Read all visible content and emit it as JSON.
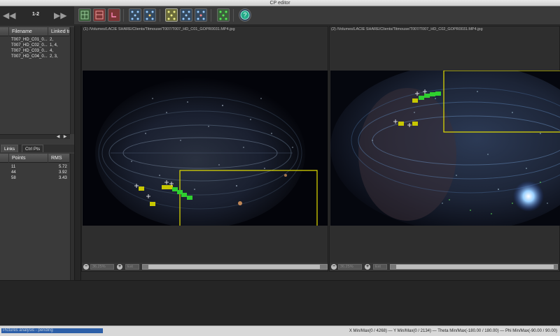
{
  "window": {
    "title": "CP editor"
  },
  "nav": {
    "pair": "1-2"
  },
  "images_table": {
    "headers": [
      "Filename",
      "Linked to"
    ],
    "rows": [
      {
        "filename": "T007_HD_C01_0...",
        "linked": "2,"
      },
      {
        "filename": "T007_HD_C02_0...",
        "linked": "1, 4,"
      },
      {
        "filename": "T007_HD_C03_0...",
        "linked": "4,"
      },
      {
        "filename": "T007_HD_C04_0...",
        "linked": "2, 3,"
      }
    ]
  },
  "tabs": [
    "Links",
    "Ctrl Pts"
  ],
  "links_table": {
    "headers": [
      "",
      "Points",
      "RMS"
    ],
    "rows": [
      {
        "points": "11",
        "rms": "5.72"
      },
      {
        "points": "44",
        "rms": "3.92"
      },
      {
        "points": "58",
        "rms": "3.43"
      }
    ]
  },
  "pane_left": {
    "path": "(1) /Volumes/LACIE SHARE/Clients/Titmouse/T007/T007_HD_C01_GOPR0031.MP4.jpg",
    "zoom": "36.25%",
    "ext": "Ext"
  },
  "pane_right": {
    "path": "(2) /Volumes/LACIE SHARE/Clients/Titmouse/T007/T007_HD_C02_GOPR0031.MP4.jpg",
    "zoom": "36.25%",
    "ext": "Ext"
  },
  "status": {
    "left": "Pictures analysis - pending",
    "right": "X Min/Max(0 / 4268)  —  Y Min/Max(0 / 2134)  —  Theta Min/Max(-180.00 / 180.00)  —  Phi Min/Max(-90.00 / 90.00)"
  },
  "colors": {
    "accent": "#6b6b3a",
    "selection": "#e5e000",
    "point_match": "#2fd02f",
    "point_pending": "#c7c700"
  }
}
